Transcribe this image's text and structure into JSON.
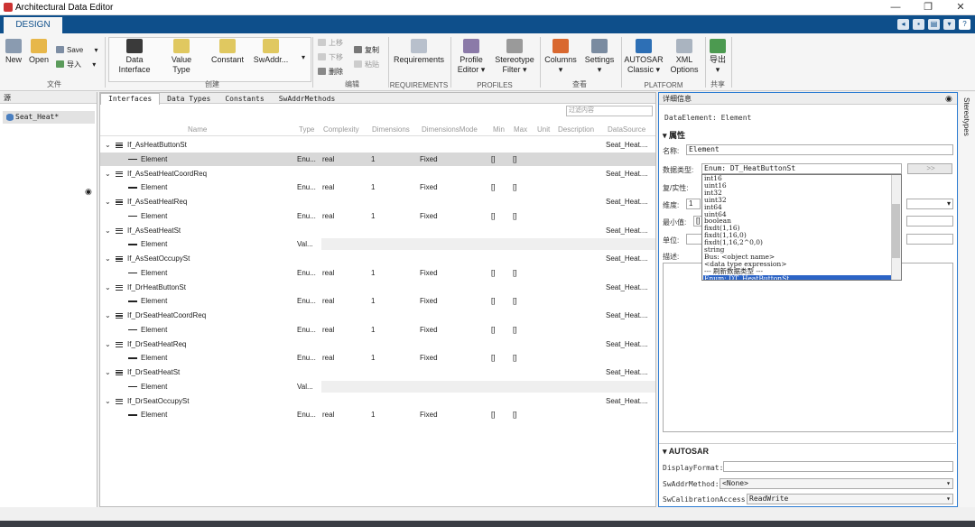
{
  "window": {
    "title": "Architectural Data Editor",
    "controls": [
      "—",
      "❐",
      "✕"
    ]
  },
  "ribbon_tab": "DESIGN",
  "ribbon": {
    "new": "New",
    "open": "Open",
    "save": "Save",
    "import": "导入",
    "file_group": "文件",
    "data_interface": [
      "Data",
      "Interface"
    ],
    "value_type": [
      "Value",
      "Type"
    ],
    "constant": "Constant",
    "swaddr": "SwAddr...",
    "create_group": "创建",
    "move_up": "上移",
    "move_down": "下移",
    "delete": "删除",
    "copy": "复制",
    "paste": "粘贴",
    "edit_group": "编辑",
    "requirements": "Requirements",
    "requirements_group": "REQUIREMENTS",
    "profile_editor": [
      "Profile",
      "Editor ▾"
    ],
    "stereotype_filter": [
      "Stereotype",
      "Filter ▾"
    ],
    "profiles_group": "PROFILES",
    "columns": "Columns",
    "settings": "Settings",
    "view_group": "查看",
    "autosar_classic": [
      "AUTOSAR",
      "Classic ▾"
    ],
    "xml_options": [
      "XML",
      "Options"
    ],
    "platform_group": "PLATFORM",
    "export": "导出",
    "share_group": "共享"
  },
  "source_panel": {
    "header": "源",
    "item": "Seat_Heat*"
  },
  "center": {
    "tabs": [
      "Interfaces",
      "Data Types",
      "Constants",
      "SwAddrMethods"
    ],
    "filter_placeholder": "过滤内容",
    "columns": [
      "Name",
      "Type",
      "Complexity",
      "Dimensions",
      "DimensionsMode",
      "Min",
      "Max",
      "Unit",
      "Description",
      "DataSource"
    ],
    "rows": [
      {
        "kind": "iface",
        "name": "If_AsHeatButtonSt",
        "src": "Seat_Heat...."
      },
      {
        "kind": "elem",
        "name": "Element",
        "type": "Enu...",
        "cx": "real",
        "dim": "1",
        "mode": "Fixed",
        "min": "[]",
        "max": "[]",
        "sel": true
      },
      {
        "kind": "iface",
        "name": "If_AsSeatHeatCoordReq",
        "src": "Seat_Heat...."
      },
      {
        "kind": "elem",
        "name": "Element",
        "type": "Enu...",
        "cx": "real",
        "dim": "1",
        "mode": "Fixed",
        "min": "[]",
        "max": "[]"
      },
      {
        "kind": "iface",
        "name": "If_AsSeatHeatReq",
        "src": "Seat_Heat...."
      },
      {
        "kind": "elem",
        "name": "Element",
        "type": "Enu...",
        "cx": "real",
        "dim": "1",
        "mode": "Fixed",
        "min": "[]",
        "max": "[]"
      },
      {
        "kind": "iface",
        "name": "If_AsSeatHeatSt",
        "src": "Seat_Heat...."
      },
      {
        "kind": "elem",
        "name": "Element",
        "type": "Val...",
        "cx": "",
        "dim": "",
        "mode": "",
        "min": "",
        "max": "",
        "gray": true
      },
      {
        "kind": "iface",
        "name": "If_AsSeatOccupySt",
        "src": "Seat_Heat...."
      },
      {
        "kind": "elem",
        "name": "Element",
        "type": "Enu...",
        "cx": "real",
        "dim": "1",
        "mode": "Fixed",
        "min": "[]",
        "max": "[]"
      },
      {
        "kind": "iface",
        "name": "If_DrHeatButtonSt",
        "src": "Seat_Heat...."
      },
      {
        "kind": "elem",
        "name": "Element",
        "type": "Enu...",
        "cx": "real",
        "dim": "1",
        "mode": "Fixed",
        "min": "[]",
        "max": "[]"
      },
      {
        "kind": "iface",
        "name": "If_DrSeatHeatCoordReq",
        "src": "Seat_Heat...."
      },
      {
        "kind": "elem",
        "name": "Element",
        "type": "Enu...",
        "cx": "real",
        "dim": "1",
        "mode": "Fixed",
        "min": "[]",
        "max": "[]"
      },
      {
        "kind": "iface",
        "name": "If_DrSeatHeatReq",
        "src": "Seat_Heat...."
      },
      {
        "kind": "elem",
        "name": "Element",
        "type": "Enu...",
        "cx": "real",
        "dim": "1",
        "mode": "Fixed",
        "min": "[]",
        "max": "[]"
      },
      {
        "kind": "iface",
        "name": "If_DrSeatHeatSt",
        "src": "Seat_Heat...."
      },
      {
        "kind": "elem",
        "name": "Element",
        "type": "Val...",
        "cx": "",
        "dim": "",
        "mode": "",
        "min": "",
        "max": "",
        "gray": true
      },
      {
        "kind": "iface",
        "name": "If_DrSeatOccupySt",
        "src": "Seat_Heat...."
      },
      {
        "kind": "elem",
        "name": "Element",
        "type": "Enu...",
        "cx": "real",
        "dim": "1",
        "mode": "Fixed",
        "min": "[]",
        "max": "[]"
      }
    ]
  },
  "details": {
    "header": "详细信息",
    "subtitle": "DataElement: Element",
    "section_props": "属性",
    "name_label": "名称:",
    "name_value": "Element",
    "dtype_label": "数据类型:",
    "dtype_value": "Enum: DT_HeatButtonSt",
    "dtype_btn": ">>",
    "complexity_label": "复/实性:",
    "dim_label": "维度:",
    "dim_value": "1",
    "min_label": "最小值:",
    "min_value": "[]",
    "unit_label": "单位:",
    "desc_label": "描述:",
    "section_autosar": "AUTOSAR",
    "display_format_label": "DisplayFormat:",
    "display_format_value": "",
    "swaddr_label": "SwAddrMethod:",
    "swaddr_value": "<None>",
    "swcal_label": "SwCalibrationAccess:",
    "swcal_value": "ReadWrite"
  },
  "dropdown": {
    "options": [
      "int16",
      "uint16",
      "int32",
      "uint32",
      "int64",
      "uint64",
      "boolean",
      "fixdt(1,16)",
      "fixdt(1,16,0)",
      "fixdt(1,16,2^0,0)",
      "string",
      "Bus: <object name>",
      "<data type expression>",
      "--- 刷新数据类型 ---",
      "Enum: DT_HeatButtonSt"
    ],
    "selected_index": 14
  },
  "stereotypes": "Stereotypes",
  "colors": {
    "accent": "#0e4f8b",
    "selection": "#2c64c6",
    "focus_border": "#2b7bd2"
  }
}
